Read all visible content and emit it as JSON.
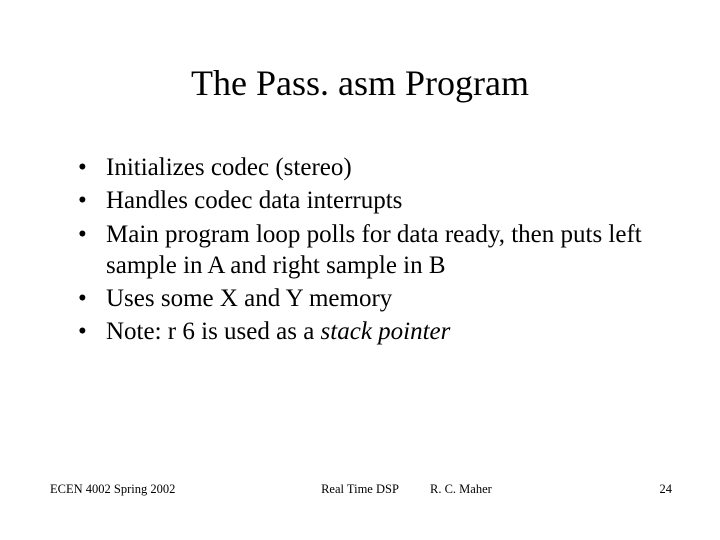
{
  "title": "The Pass. asm Program",
  "bullets": {
    "b0": "Initializes codec (stereo)",
    "b1": "Handles codec data interrupts",
    "b2": "Main program loop polls for data ready, then puts left sample in A and right sample in B",
    "b3": "Uses some X and Y memory",
    "b4_pre": "Note:  r 6 is used as a ",
    "b4_em": "stack pointer"
  },
  "footer": {
    "left": "ECEN 4002 Spring 2002",
    "center": "Real Time DSP",
    "author": "R. C. Maher",
    "page": "24"
  }
}
